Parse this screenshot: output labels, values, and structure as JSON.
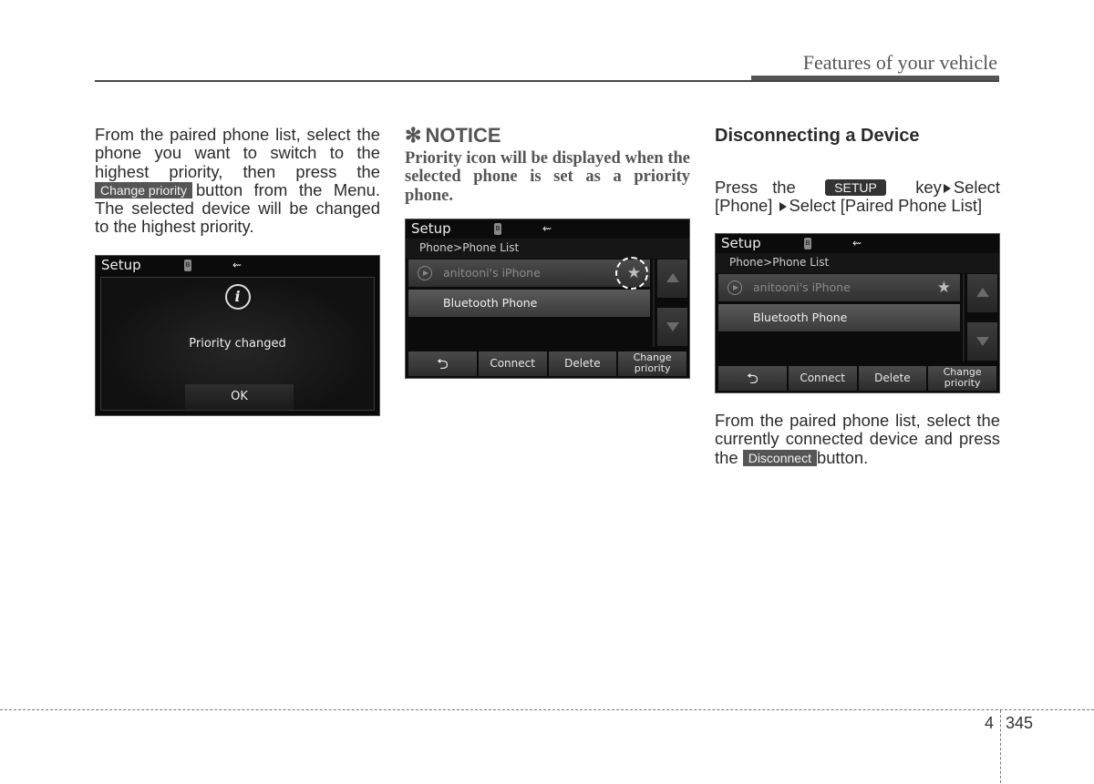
{
  "header": {
    "section_title": "Features of your vehicle"
  },
  "col1": {
    "para_before": "From the paired phone list, select the phone you want to switch to the highest priority, then press the",
    "inline_button": "Change priority",
    "para_after": "button from the Menu. The selected device will be changed to the highest priority.",
    "screen": {
      "title": "Setup",
      "bt_glyph": "ʙ",
      "usb_glyph": "⇜",
      "info_glyph": "i",
      "message": "Priority changed",
      "ok_label": "OK"
    }
  },
  "col2": {
    "notice_star": "✻",
    "notice_heading": "NOTICE",
    "notice_body": "Priority icon will be displayed when the selected phone is set as a priority phone.",
    "screen": {
      "title": "Setup",
      "bt_glyph": "ʙ",
      "usb_glyph": "⇜",
      "breadcrumb": "Phone>Phone List",
      "phones": [
        {
          "name": "anitooni's iPhone",
          "priority": true
        },
        {
          "name": "Bluetooth Phone",
          "priority": false
        }
      ],
      "star_glyph": "★",
      "back_glyph": "⮌",
      "buttons": {
        "connect": "Connect",
        "delete": "Delete",
        "change_priority_1": "Change",
        "change_priority_2": "priority"
      }
    }
  },
  "col3": {
    "heading": "Disconnecting a Device",
    "press_the": "Press the",
    "setup_key": "SETUP",
    "key_select": "key",
    "select1": "Select",
    "phone_bracket": "[Phone]",
    "select2": "Select [Paired Phone List]",
    "screen": {
      "title": "Setup",
      "bt_glyph": "ʙ",
      "usb_glyph": "⇜",
      "breadcrumb": "Phone>Phone List",
      "phones": [
        {
          "name": "anitooni's iPhone",
          "priority": true
        },
        {
          "name": "Bluetooth Phone",
          "priority": false
        }
      ],
      "star_glyph": "★",
      "back_glyph": "⮌",
      "buttons": {
        "connect": "Connect",
        "delete": "Delete",
        "change_priority_1": "Change",
        "change_priority_2": "priority"
      }
    },
    "para_before": "From the paired phone list, select the currently connected device and press the",
    "inline_button": "Disconnect",
    "para_after": "button."
  },
  "footer": {
    "chapter": "4",
    "page": "345"
  }
}
